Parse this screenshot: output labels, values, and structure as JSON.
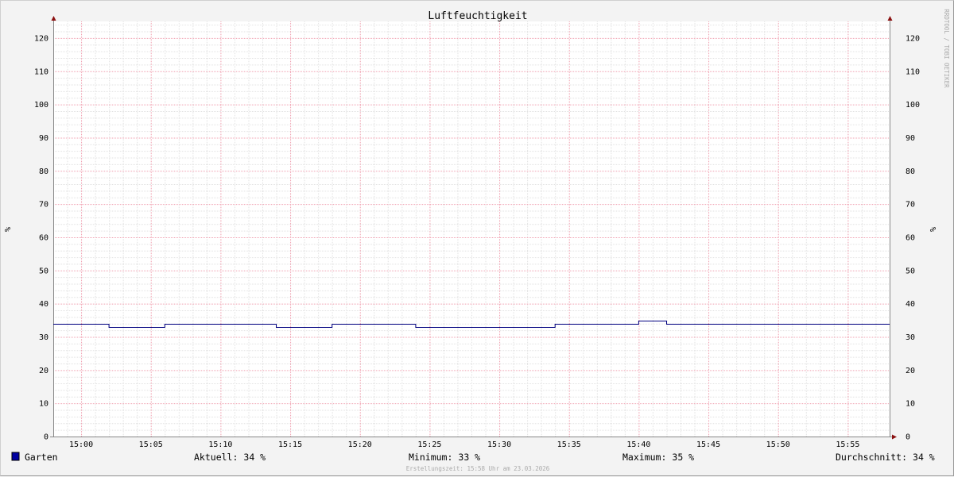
{
  "chart_data": {
    "type": "line",
    "title": "Luftfeuchtigkeit",
    "ylabel_left": "%",
    "ylabel_right": "%",
    "ylim": [
      0,
      125
    ],
    "y_ticks": [
      0,
      10,
      20,
      30,
      40,
      50,
      60,
      70,
      80,
      90,
      100,
      110,
      120
    ],
    "x_range_minutes": [
      "14:58",
      "15:58"
    ],
    "x_ticks": [
      "15:00",
      "15:05",
      "15:10",
      "15:15",
      "15:20",
      "15:25",
      "15:30",
      "15:35",
      "15:40",
      "15:45",
      "15:50",
      "15:55"
    ],
    "grid": true,
    "series": [
      {
        "name": "Garten",
        "color": "#000080",
        "points": [
          [
            "14:58",
            34
          ],
          [
            "15:02",
            34
          ],
          [
            "15:02",
            33
          ],
          [
            "15:06",
            33
          ],
          [
            "15:06",
            34
          ],
          [
            "15:14",
            34
          ],
          [
            "15:14",
            33
          ],
          [
            "15:18",
            33
          ],
          [
            "15:18",
            34
          ],
          [
            "15:24",
            34
          ],
          [
            "15:24",
            33
          ],
          [
            "15:34",
            33
          ],
          [
            "15:34",
            34
          ],
          [
            "15:40",
            34
          ],
          [
            "15:40",
            35
          ],
          [
            "15:42",
            35
          ],
          [
            "15:42",
            34
          ],
          [
            "15:58",
            34
          ]
        ]
      }
    ],
    "legend": {
      "series_name": "Garten",
      "swatch_color": "#0000a0",
      "stats": [
        {
          "label": "Aktuell:",
          "value": "34 %"
        },
        {
          "label": "Minimum:",
          "value": "33 %"
        },
        {
          "label": "Maximum:",
          "value": "35 %"
        },
        {
          "label": "Durchschnitt:",
          "value": "34 %"
        }
      ]
    },
    "watermark": "RRDTOOL / TOBI OETIKER",
    "footer": "Erstellungszeit: 15:58 Uhr am 23.03.2026"
  }
}
